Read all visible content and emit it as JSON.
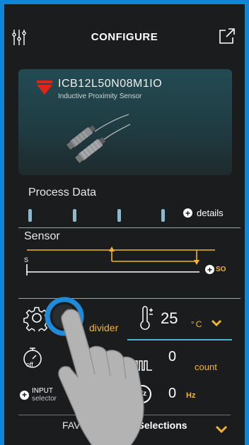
{
  "header": {
    "title": "CONFIGURE",
    "left_icon": "sliders-icon",
    "right_icon": "external-link-icon"
  },
  "product": {
    "model": "ICB12L50N08M1IO",
    "type": "Inductive Proximity Sensor",
    "logo_icon": "carlo-gavazzi-logo-icon"
  },
  "process_data": {
    "title": "Process Data",
    "details_label": "details"
  },
  "sensor": {
    "title": "Sensor",
    "s_marker": "S",
    "so_label": "SO"
  },
  "config": {
    "divider_label": "divider",
    "temperature_value": "25",
    "temperature_unit": "°C"
  },
  "timer": {
    "off_label": "off",
    "count_value": "0",
    "count_label": "count"
  },
  "input": {
    "label": "INPUT",
    "sublabel": "selector",
    "hz_icon_text": "Hz",
    "hz_value": "0",
    "hz_unit": "Hz"
  },
  "favourite": {
    "label_left": "FAVOUR",
    "label_right": "Selections"
  },
  "colors": {
    "accent_yellow": "#f3b52a",
    "accent_cyan": "#4bb4c8",
    "dial_blue": "#1e8ad8",
    "background": "#1a1c1e",
    "frame_blue": "#1185d6",
    "brand_red": "#e2231a"
  }
}
